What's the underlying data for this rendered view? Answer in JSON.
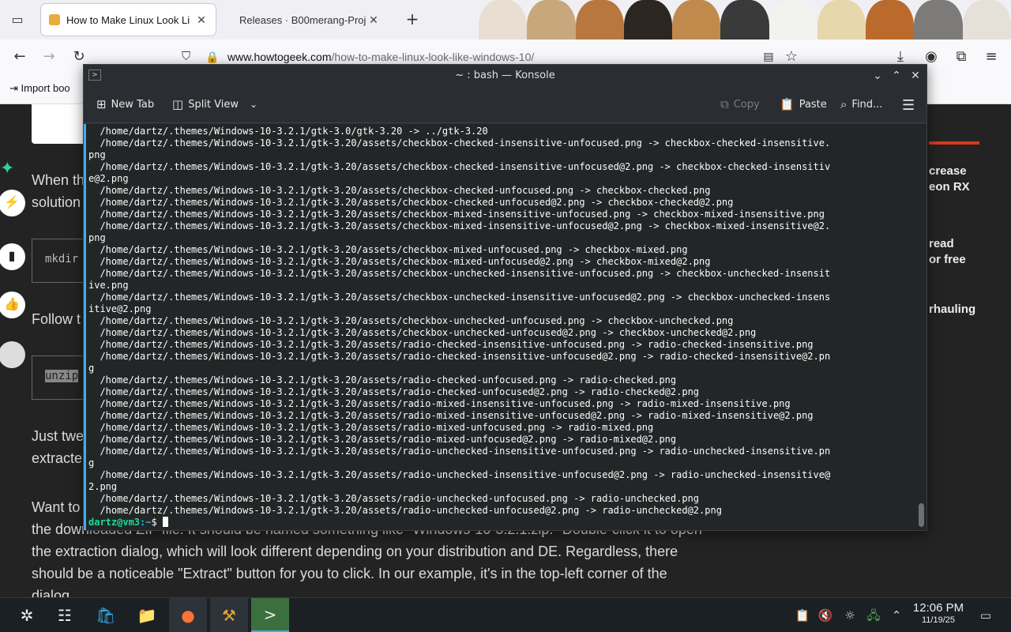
{
  "browser": {
    "tabs": [
      {
        "title": "How to Make Linux Look Li",
        "active": true
      },
      {
        "title": "Releases · B00merang-Proj",
        "active": false
      }
    ],
    "url_host": "www.howtogeek.com",
    "url_path": "/how-to-make-linux-look-like-windows-10/",
    "bookmark": "Import boo"
  },
  "article": {
    "p1_a": "When th",
    "p1_b": "solution",
    "code1": "mkdir",
    "p2": "Follow t",
    "code2": "unzip",
    "p3_a": "Just twe",
    "p3_b": "extracte",
    "p4_a": "Want to",
    "p4_b": "the downloaded ZIP file. It should be named something like \"Windows-10-3.2.1.zip.\" Double-click it to open",
    "p4_c": "the extraction dialog, which will look different depending on your distribution and DE. Regardless, there",
    "p4_d": "should be a noticeable \"Extract\" button for you to click. In our example, it's in the top-left corner of the",
    "p4_e": "dialog.",
    "sidebar": [
      "crease",
      "eon RX",
      "read",
      "or free",
      "rhauling"
    ]
  },
  "konsole": {
    "title": "~ : bash — Konsole",
    "toolbar": {
      "new_tab": "New Tab",
      "split_view": "Split View",
      "copy": "Copy",
      "paste": "Paste",
      "find": "Find..."
    },
    "lines": [
      "  /home/dartz/.themes/Windows-10-3.2.1/gtk-3.0/gtk-3.20 -> ../gtk-3.20",
      "  /home/dartz/.themes/Windows-10-3.2.1/gtk-3.20/assets/checkbox-checked-insensitive-unfocused.png -> checkbox-checked-insensitive.",
      "png",
      "  /home/dartz/.themes/Windows-10-3.2.1/gtk-3.20/assets/checkbox-checked-insensitive-unfocused@2.png -> checkbox-checked-insensitiv",
      "e@2.png",
      "  /home/dartz/.themes/Windows-10-3.2.1/gtk-3.20/assets/checkbox-checked-unfocused.png -> checkbox-checked.png",
      "  /home/dartz/.themes/Windows-10-3.2.1/gtk-3.20/assets/checkbox-checked-unfocused@2.png -> checkbox-checked@2.png",
      "  /home/dartz/.themes/Windows-10-3.2.1/gtk-3.20/assets/checkbox-mixed-insensitive-unfocused.png -> checkbox-mixed-insensitive.png",
      "  /home/dartz/.themes/Windows-10-3.2.1/gtk-3.20/assets/checkbox-mixed-insensitive-unfocused@2.png -> checkbox-mixed-insensitive@2.",
      "png",
      "  /home/dartz/.themes/Windows-10-3.2.1/gtk-3.20/assets/checkbox-mixed-unfocused.png -> checkbox-mixed.png",
      "  /home/dartz/.themes/Windows-10-3.2.1/gtk-3.20/assets/checkbox-mixed-unfocused@2.png -> checkbox-mixed@2.png",
      "  /home/dartz/.themes/Windows-10-3.2.1/gtk-3.20/assets/checkbox-unchecked-insensitive-unfocused.png -> checkbox-unchecked-insensit",
      "ive.png",
      "  /home/dartz/.themes/Windows-10-3.2.1/gtk-3.20/assets/checkbox-unchecked-insensitive-unfocused@2.png -> checkbox-unchecked-insens",
      "itive@2.png",
      "  /home/dartz/.themes/Windows-10-3.2.1/gtk-3.20/assets/checkbox-unchecked-unfocused.png -> checkbox-unchecked.png",
      "  /home/dartz/.themes/Windows-10-3.2.1/gtk-3.20/assets/checkbox-unchecked-unfocused@2.png -> checkbox-unchecked@2.png",
      "  /home/dartz/.themes/Windows-10-3.2.1/gtk-3.20/assets/radio-checked-insensitive-unfocused.png -> radio-checked-insensitive.png",
      "  /home/dartz/.themes/Windows-10-3.2.1/gtk-3.20/assets/radio-checked-insensitive-unfocused@2.png -> radio-checked-insensitive@2.pn",
      "g",
      "  /home/dartz/.themes/Windows-10-3.2.1/gtk-3.20/assets/radio-checked-unfocused.png -> radio-checked.png",
      "  /home/dartz/.themes/Windows-10-3.2.1/gtk-3.20/assets/radio-checked-unfocused@2.png -> radio-checked@2.png",
      "  /home/dartz/.themes/Windows-10-3.2.1/gtk-3.20/assets/radio-mixed-insensitive-unfocused.png -> radio-mixed-insensitive.png",
      "  /home/dartz/.themes/Windows-10-3.2.1/gtk-3.20/assets/radio-mixed-insensitive-unfocused@2.png -> radio-mixed-insensitive@2.png",
      "  /home/dartz/.themes/Windows-10-3.2.1/gtk-3.20/assets/radio-mixed-unfocused.png -> radio-mixed.png",
      "  /home/dartz/.themes/Windows-10-3.2.1/gtk-3.20/assets/radio-mixed-unfocused@2.png -> radio-mixed@2.png",
      "  /home/dartz/.themes/Windows-10-3.2.1/gtk-3.20/assets/radio-unchecked-insensitive-unfocused.png -> radio-unchecked-insensitive.pn",
      "g",
      "  /home/dartz/.themes/Windows-10-3.2.1/gtk-3.20/assets/radio-unchecked-insensitive-unfocused@2.png -> radio-unchecked-insensitive@",
      "2.png",
      "  /home/dartz/.themes/Windows-10-3.2.1/gtk-3.20/assets/radio-unchecked-unfocused.png -> radio-unchecked.png",
      "  /home/dartz/.themes/Windows-10-3.2.1/gtk-3.20/assets/radio-unchecked-unfocused@2.png -> radio-unchecked@2.png"
    ],
    "prompt_user": "dartz@vm3",
    "prompt_path": ":~",
    "prompt_symbol": "$ "
  },
  "taskbar": {
    "time": "12:06 PM",
    "date": "11/19/25"
  },
  "colors": {
    "konsole_bg": "#232627",
    "prompt_green": "#1cdc9a",
    "prompt_blue": "#3daee9",
    "accent_red": "#d9391d"
  }
}
